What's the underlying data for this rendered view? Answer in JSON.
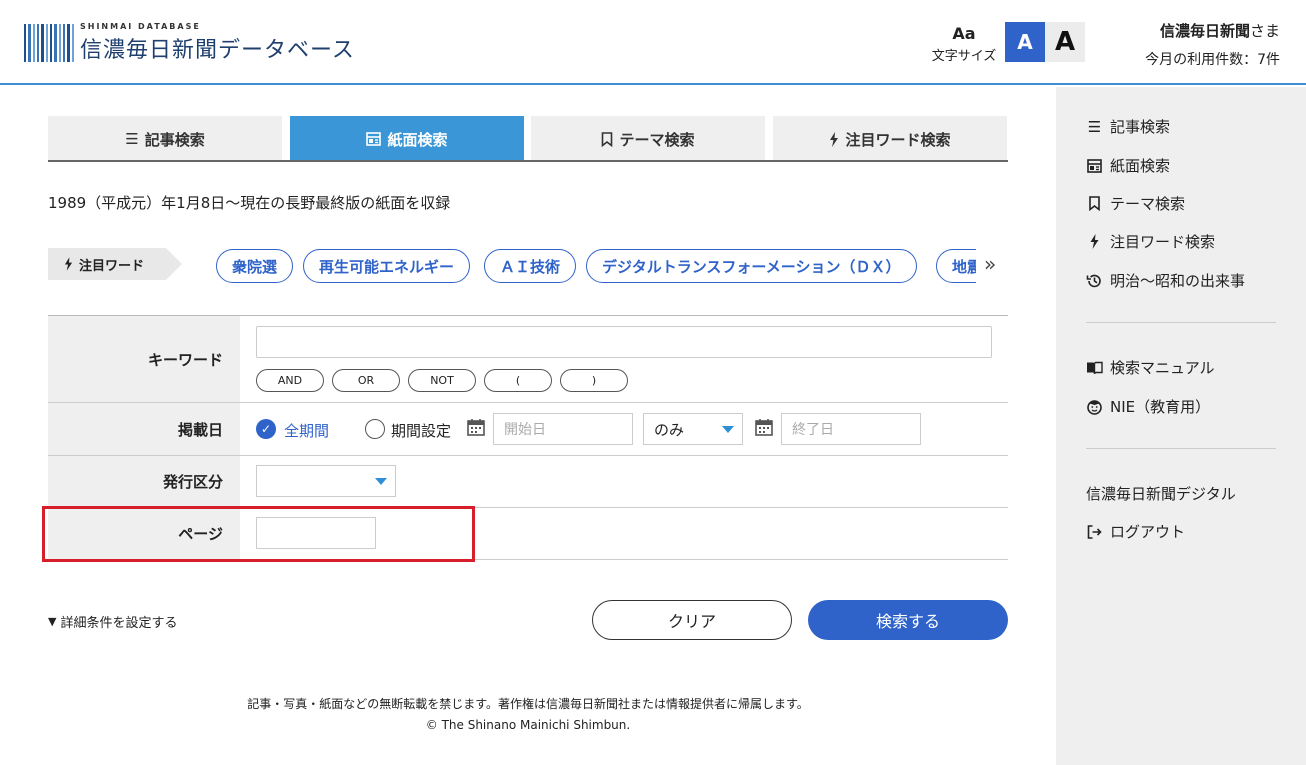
{
  "header": {
    "logo_sub": "SHINMAI DATABASE",
    "logo_main": "信濃毎日新聞データベース",
    "font_size_icon": "Aa",
    "font_size_label": "文字サイズ",
    "font_small": "A",
    "font_large": "A",
    "user_name": "信濃毎日新聞",
    "user_suffix": "さま",
    "usage": "今月の利用件数：7件"
  },
  "tabs": [
    {
      "label": "記事検索",
      "icon": "list-icon"
    },
    {
      "label": "紙面検索",
      "icon": "newspaper-icon"
    },
    {
      "label": "テーマ検索",
      "icon": "bookmark-icon"
    },
    {
      "label": "注目ワード検索",
      "icon": "lightning-icon"
    }
  ],
  "notice": "1989（平成元）年1月8日〜現在の長野最終版の紙面を収録",
  "attention": {
    "label": "注目ワード",
    "chips": [
      "衆院選",
      "再生可能エネルギー",
      "ＡＩ技術",
      "デジタルトランスフォーメーション（ＤＸ）",
      "地震"
    ],
    "next": "»"
  },
  "form": {
    "keyword_label": "キーワード",
    "operators": [
      "AND",
      "OR",
      "NOT",
      "(",
      ")"
    ],
    "date_label": "掲載日",
    "all_period": "全期間",
    "period_setting": "期間設定",
    "start_placeholder": "開始日",
    "mode_value": "のみ",
    "end_placeholder": "終了日",
    "issue_label": "発行区分",
    "page_label": "ページ"
  },
  "actions": {
    "detail": "詳細条件を設定する",
    "clear": "クリア",
    "search": "検索する"
  },
  "sidebar": {
    "items": [
      {
        "label": "記事検索",
        "icon": "list-icon"
      },
      {
        "label": "紙面検索",
        "icon": "newspaper-icon"
      },
      {
        "label": "テーマ検索",
        "icon": "bookmark-icon"
      },
      {
        "label": "注目ワード検索",
        "icon": "lightning-icon"
      },
      {
        "label": "明治〜昭和の出来事",
        "icon": "history-icon"
      }
    ],
    "manual": "検索マニュアル",
    "nie": "NIE（教育用）",
    "digital": "信濃毎日新聞デジタル",
    "logout": "ログアウト"
  },
  "footer": {
    "notice": "記事・写真・紙面などの無断転載を禁じます。著作権は信濃毎日新聞社または情報提供者に帰属します。",
    "copyright": "© The Shinano Mainichi Shimbun."
  },
  "colors": {
    "accent": "#2f63c9",
    "tab_active": "#3a96d6",
    "highlight": "#d81e2a"
  }
}
